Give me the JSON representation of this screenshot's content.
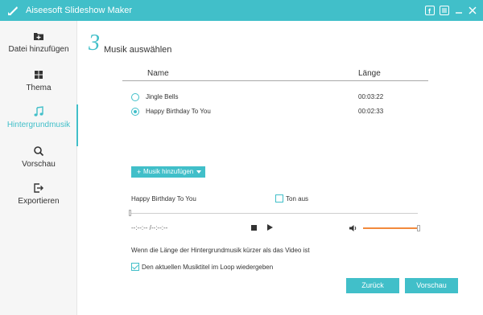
{
  "window": {
    "title": "Aiseesoft Slideshow Maker",
    "accent_color": "#41bfc9",
    "controls": [
      "facebook-icon",
      "menu-icon",
      "minimize-icon",
      "close-icon"
    ]
  },
  "sidebar": {
    "items": [
      {
        "label": "Datei hinzufügen",
        "icon": "folder-add-icon",
        "active": false
      },
      {
        "label": "Thema",
        "icon": "grid-icon",
        "active": false
      },
      {
        "label": "Hintergrundmusik",
        "icon": "music-note-icon",
        "active": true
      },
      {
        "label": "Vorschau",
        "icon": "search-icon",
        "active": false
      },
      {
        "label": "Exportieren",
        "icon": "export-icon",
        "active": false
      }
    ]
  },
  "step": {
    "number": "3",
    "title": "Musik auswählen"
  },
  "table": {
    "columns": [
      "Name",
      "Länge"
    ],
    "rows": [
      {
        "name": "Jingle Bells",
        "length": "00:03:22",
        "selected": false
      },
      {
        "name": "Happy Birthday To You",
        "length": "00:02:33",
        "selected": true
      }
    ]
  },
  "add_music_button": "Musik hinzufügen",
  "player": {
    "current_track": "Happy Birthday To You",
    "mute_label": "Ton aus",
    "mute_checked": false,
    "time": "--:--:-- /--:--:--",
    "seek_fraction": 0,
    "volume_fraction": 1.0,
    "volume_color": "#f28a3c"
  },
  "hint_text": "Wenn die Länge der Hintergrundmusik kürzer als das Video ist",
  "loop_label": "Den aktuellen Musiktitel im Loop wiedergeben",
  "loop_checked": true,
  "buttons": {
    "back": "Zurück",
    "preview": "Vorschau"
  }
}
